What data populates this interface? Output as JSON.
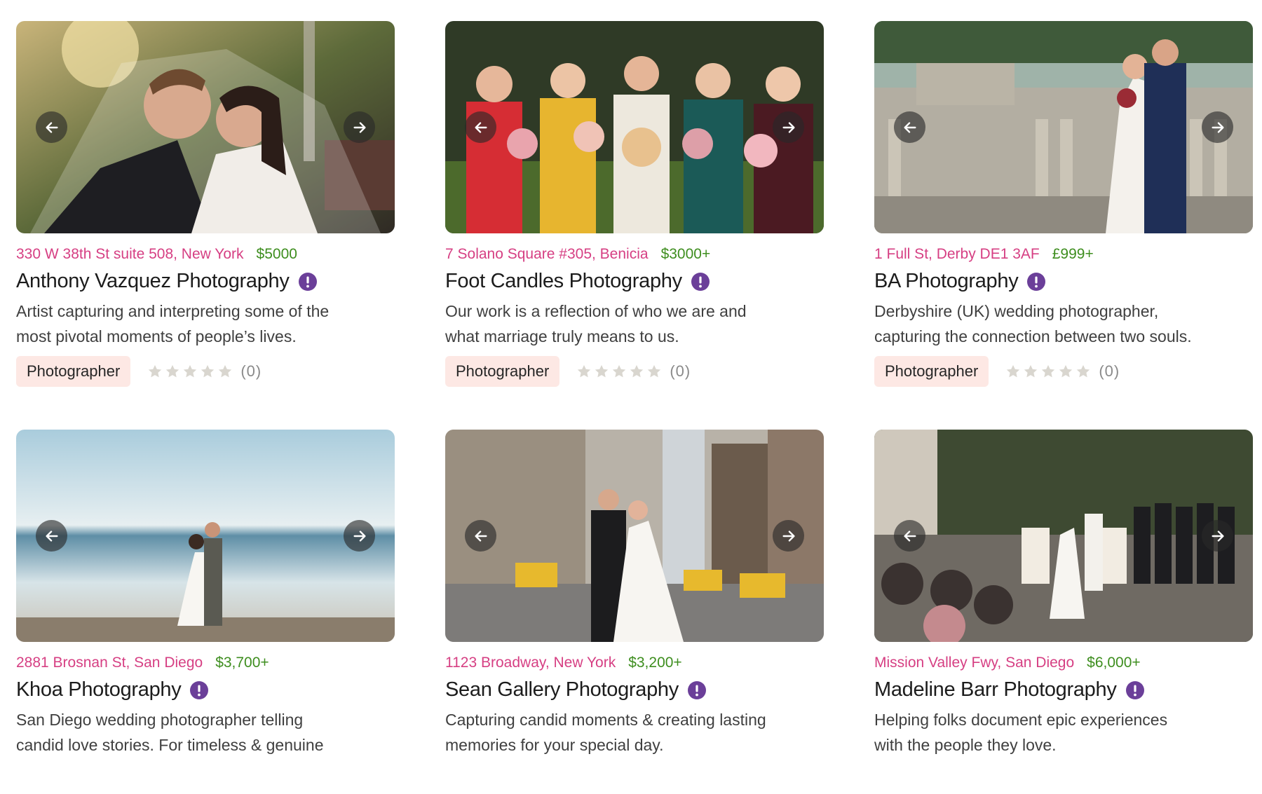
{
  "colors": {
    "address": "#d63f83",
    "price": "#3e8e1f",
    "verified": "#6b3f99",
    "tag_bg": "#fde8e4",
    "star": "#d9d6cf"
  },
  "icons": {
    "prev": "arrow-left-icon",
    "next": "arrow-right-icon",
    "verified": "verified-badge-icon",
    "star": "star-icon"
  },
  "listings": [
    {
      "address": "330 W 38th St suite 508, New York",
      "price": "$5000",
      "name": "Anthony Vazquez Photography",
      "desc_line1": "Artist capturing and interpreting some of the",
      "desc_line2": "most pivotal moments of people’s lives.",
      "tag": "Photographer",
      "rating": 0,
      "review_count": "(0)"
    },
    {
      "address": "7 Solano Square #305, Benicia",
      "price": "$3000+",
      "name": "Foot Candles Photography",
      "desc_line1": "Our work is a reflection of who we are and",
      "desc_line2": "what marriage truly means to us.",
      "tag": "Photographer",
      "rating": 0,
      "review_count": "(0)"
    },
    {
      "address": "1 Full St, Derby DE1 3AF",
      "price": "£999+",
      "name": "BA Photography",
      "desc_line1": "Derbyshire (UK) wedding photographer,",
      "desc_line2": "capturing the connection between two souls.",
      "tag": "Photographer",
      "rating": 0,
      "review_count": "(0)"
    },
    {
      "address": "2881 Brosnan St, San Diego",
      "price": "$3,700+",
      "name": "Khoa Photography",
      "desc_line1": "San Diego wedding photographer telling",
      "desc_line2": "candid love stories. For timeless & genuine"
    },
    {
      "address": "1123 Broadway, New York",
      "price": "$3,200+",
      "name": "Sean Gallery Photography",
      "desc_line1": "Capturing candid moments & creating lasting",
      "desc_line2": "memories for your special day."
    },
    {
      "address": "Mission Valley Fwy, San Diego",
      "price": "$6,000+",
      "name": "Madeline Barr Photography",
      "desc_line1": "Helping folks document epic experiences",
      "desc_line2": "with the people they love."
    }
  ]
}
